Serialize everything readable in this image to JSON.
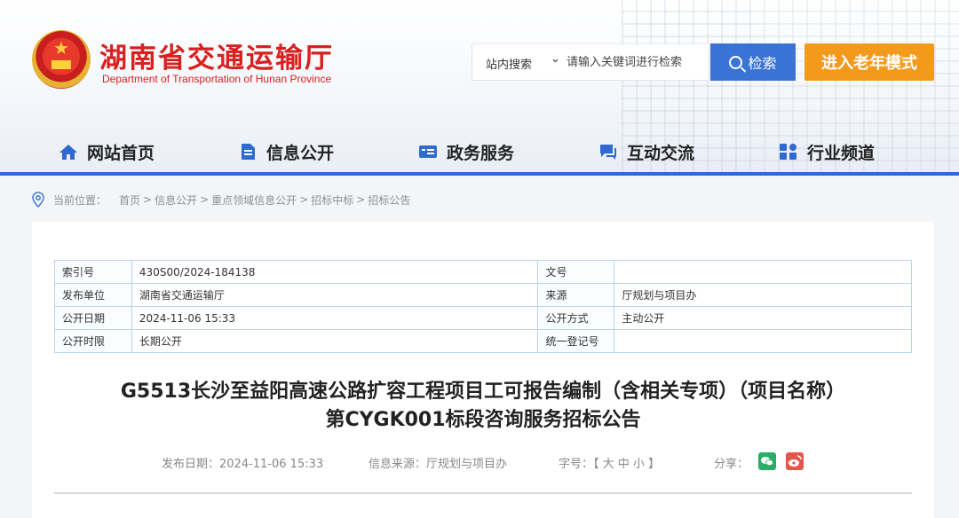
{
  "header": {
    "site_title": "湖南省交通运输厅",
    "site_subtitle": "Department of Transportation of Hunan Province",
    "search_scope": "站内搜索",
    "search_placeholder": "请输入关键词进行检索",
    "search_button": "检索",
    "elder_mode_button": "进入老年模式"
  },
  "nav": {
    "items": [
      {
        "label": "网站首页",
        "icon": "home-icon"
      },
      {
        "label": "信息公开",
        "icon": "document-icon"
      },
      {
        "label": "政务服务",
        "icon": "service-card-icon"
      },
      {
        "label": "互动交流",
        "icon": "chat-icon"
      },
      {
        "label": "行业频道",
        "icon": "grid-icon"
      }
    ]
  },
  "breadcrumb": {
    "prefix": "当前位置：",
    "path": [
      "首页",
      "信息公开",
      "重点领域信息公开",
      "招标中标",
      "招标公告"
    ],
    "separator": ">"
  },
  "meta_table": {
    "rows": [
      {
        "k1": "索引号",
        "v1": "430S00/2024-184138",
        "k2": "文号",
        "v2": ""
      },
      {
        "k1": "发布单位",
        "v1": "湖南省交通运输厅",
        "k2": "来源",
        "v2": "厅规划与项目办"
      },
      {
        "k1": "公开日期",
        "v1": "2024-11-06 15:33",
        "k2": "公开方式",
        "v2": "主动公开"
      },
      {
        "k1": "公开时限",
        "v1": "长期公开",
        "k2": "统一登记号",
        "v2": ""
      }
    ]
  },
  "article": {
    "title_line1": "G5513长沙至益阳高速公路扩容工程项目工可报告编制（含相关专项）（项目名称）",
    "title_line2": "第CYGK001标段咨询服务招标公告",
    "publish_date": "发布日期：2024-11-06 15:33",
    "source": "信息来源：厅规划与项目办",
    "font_size_label": "字号：【 大 中 小 】",
    "share_label": "分享："
  },
  "colors": {
    "brand_red": "#d8201f",
    "nav_blue": "#2f6ad0",
    "search_blue": "#3a73d6",
    "elder_orange": "#f39a1d",
    "wechat_green": "#2aae67",
    "weibo_red": "#e6554a"
  }
}
